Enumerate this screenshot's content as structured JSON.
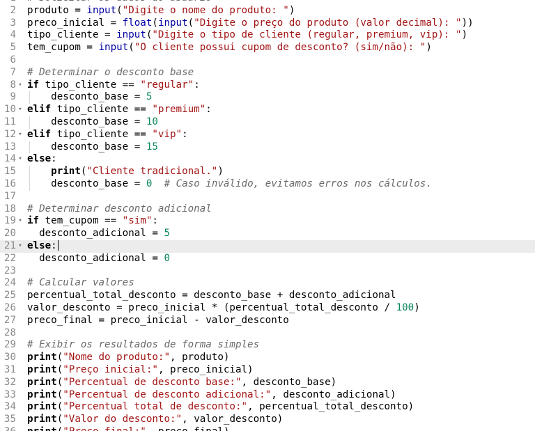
{
  "editor": {
    "colors": {
      "keyword": "#000000",
      "function": "#0000a2",
      "string": "#a31515",
      "number": "#098658",
      "comment": "#6a6a6a",
      "gutter": "#8a8a8a",
      "active_line": "#ececec"
    },
    "fold_marker": "▾",
    "active_line_number": 21,
    "lines": [
      {
        "n": 1,
        "fold": false,
        "indent": 0,
        "tokens": [
          {
            "t": "com",
            "v": "# Solicitar os dados do usuário"
          }
        ]
      },
      {
        "n": 2,
        "fold": false,
        "indent": 0,
        "tokens": [
          {
            "t": "txt",
            "v": "produto = "
          },
          {
            "t": "fn",
            "v": "input"
          },
          {
            "t": "txt",
            "v": "("
          },
          {
            "t": "str",
            "v": "\"Digite o nome do produto: \""
          },
          {
            "t": "txt",
            "v": ")"
          }
        ]
      },
      {
        "n": 3,
        "fold": false,
        "indent": 0,
        "tokens": [
          {
            "t": "txt",
            "v": "preco_inicial = "
          },
          {
            "t": "fn",
            "v": "float"
          },
          {
            "t": "txt",
            "v": "("
          },
          {
            "t": "fn",
            "v": "input"
          },
          {
            "t": "txt",
            "v": "("
          },
          {
            "t": "str",
            "v": "\"Digite o preço do produto (valor decimal): \""
          },
          {
            "t": "txt",
            "v": "))"
          }
        ]
      },
      {
        "n": 4,
        "fold": false,
        "indent": 0,
        "tokens": [
          {
            "t": "txt",
            "v": "tipo_cliente = "
          },
          {
            "t": "fn",
            "v": "input"
          },
          {
            "t": "txt",
            "v": "("
          },
          {
            "t": "str",
            "v": "\"Digite o tipo de cliente (regular, premium, vip): \""
          },
          {
            "t": "txt",
            "v": ")"
          }
        ]
      },
      {
        "n": 5,
        "fold": false,
        "indent": 0,
        "tokens": [
          {
            "t": "txt",
            "v": "tem_cupom = "
          },
          {
            "t": "fn",
            "v": "input"
          },
          {
            "t": "txt",
            "v": "("
          },
          {
            "t": "str",
            "v": "\"O cliente possui cupom de desconto? (sim/não): \""
          },
          {
            "t": "txt",
            "v": ")"
          }
        ]
      },
      {
        "n": 6,
        "fold": false,
        "indent": 0,
        "tokens": []
      },
      {
        "n": 7,
        "fold": false,
        "indent": 0,
        "tokens": [
          {
            "t": "com",
            "v": "# Determinar o desconto base"
          }
        ]
      },
      {
        "n": 8,
        "fold": true,
        "indent": 0,
        "tokens": [
          {
            "t": "kw",
            "v": "if"
          },
          {
            "t": "txt",
            "v": " tipo_cliente == "
          },
          {
            "t": "str",
            "v": "\"regular\""
          },
          {
            "t": "txt",
            "v": ":"
          }
        ]
      },
      {
        "n": 9,
        "fold": false,
        "indent": 1,
        "tokens": [
          {
            "t": "txt",
            "v": "    desconto_base = "
          },
          {
            "t": "num",
            "v": "5"
          }
        ]
      },
      {
        "n": 10,
        "fold": true,
        "indent": 0,
        "tokens": [
          {
            "t": "kw",
            "v": "elif"
          },
          {
            "t": "txt",
            "v": " tipo_cliente == "
          },
          {
            "t": "str",
            "v": "\"premium\""
          },
          {
            "t": "txt",
            "v": ":"
          }
        ]
      },
      {
        "n": 11,
        "fold": false,
        "indent": 1,
        "tokens": [
          {
            "t": "txt",
            "v": "    desconto_base = "
          },
          {
            "t": "num",
            "v": "10"
          }
        ]
      },
      {
        "n": 12,
        "fold": true,
        "indent": 0,
        "tokens": [
          {
            "t": "kw",
            "v": "elif"
          },
          {
            "t": "txt",
            "v": " tipo_cliente == "
          },
          {
            "t": "str",
            "v": "\"vip\""
          },
          {
            "t": "txt",
            "v": ":"
          }
        ]
      },
      {
        "n": 13,
        "fold": false,
        "indent": 1,
        "tokens": [
          {
            "t": "txt",
            "v": "    desconto_base = "
          },
          {
            "t": "num",
            "v": "15"
          }
        ]
      },
      {
        "n": 14,
        "fold": true,
        "indent": 0,
        "tokens": [
          {
            "t": "kw",
            "v": "else"
          },
          {
            "t": "txt",
            "v": ":"
          }
        ]
      },
      {
        "n": 15,
        "fold": false,
        "indent": 1,
        "tokens": [
          {
            "t": "txt",
            "v": "    "
          },
          {
            "t": "kw",
            "v": "print"
          },
          {
            "t": "txt",
            "v": "("
          },
          {
            "t": "str",
            "v": "\"Cliente tradicional.\""
          },
          {
            "t": "txt",
            "v": ")"
          }
        ]
      },
      {
        "n": 16,
        "fold": false,
        "indent": 1,
        "tokens": [
          {
            "t": "txt",
            "v": "    desconto_base = "
          },
          {
            "t": "num",
            "v": "0"
          },
          {
            "t": "txt",
            "v": "  "
          },
          {
            "t": "com",
            "v": "# Caso inválido, evitamos erros nos cálculos."
          }
        ]
      },
      {
        "n": 17,
        "fold": false,
        "indent": 0,
        "tokens": []
      },
      {
        "n": 18,
        "fold": false,
        "indent": 0,
        "tokens": [
          {
            "t": "com",
            "v": "# Determinar desconto adicional"
          }
        ]
      },
      {
        "n": 19,
        "fold": true,
        "indent": 0,
        "tokens": [
          {
            "t": "kw",
            "v": "if"
          },
          {
            "t": "txt",
            "v": " tem_cupom == "
          },
          {
            "t": "str",
            "v": "\"sim\""
          },
          {
            "t": "txt",
            "v": ":"
          }
        ]
      },
      {
        "n": 20,
        "fold": false,
        "indent": 0,
        "tokens": [
          {
            "t": "txt",
            "v": "  desconto_adicional = "
          },
          {
            "t": "num",
            "v": "5"
          }
        ]
      },
      {
        "n": 21,
        "fold": true,
        "indent": 0,
        "tokens": [
          {
            "t": "kw",
            "v": "else"
          },
          {
            "t": "txt",
            "v": ":"
          }
        ]
      },
      {
        "n": 22,
        "fold": false,
        "indent": 0,
        "tokens": [
          {
            "t": "txt",
            "v": "  desconto_adicional = "
          },
          {
            "t": "num",
            "v": "0"
          }
        ]
      },
      {
        "n": 23,
        "fold": false,
        "indent": 0,
        "tokens": []
      },
      {
        "n": 24,
        "fold": false,
        "indent": 0,
        "tokens": [
          {
            "t": "com",
            "v": "# Calcular valores"
          }
        ]
      },
      {
        "n": 25,
        "fold": false,
        "indent": 0,
        "tokens": [
          {
            "t": "txt",
            "v": "percentual_total_desconto = desconto_base + desconto_adicional"
          }
        ]
      },
      {
        "n": 26,
        "fold": false,
        "indent": 0,
        "tokens": [
          {
            "t": "txt",
            "v": "valor_desconto = preco_inicial * (percentual_total_desconto / "
          },
          {
            "t": "num",
            "v": "100"
          },
          {
            "t": "txt",
            "v": ")"
          }
        ]
      },
      {
        "n": 27,
        "fold": false,
        "indent": 0,
        "tokens": [
          {
            "t": "txt",
            "v": "preco_final = preco_inicial - valor_desconto"
          }
        ]
      },
      {
        "n": 28,
        "fold": false,
        "indent": 0,
        "tokens": []
      },
      {
        "n": 29,
        "fold": false,
        "indent": 0,
        "tokens": [
          {
            "t": "com",
            "v": "# Exibir os resultados de forma simples"
          }
        ]
      },
      {
        "n": 30,
        "fold": false,
        "indent": 0,
        "tokens": [
          {
            "t": "kw",
            "v": "print"
          },
          {
            "t": "txt",
            "v": "("
          },
          {
            "t": "str",
            "v": "\"Nome do produto:\""
          },
          {
            "t": "txt",
            "v": ", produto)"
          }
        ]
      },
      {
        "n": 31,
        "fold": false,
        "indent": 0,
        "tokens": [
          {
            "t": "kw",
            "v": "print"
          },
          {
            "t": "txt",
            "v": "("
          },
          {
            "t": "str",
            "v": "\"Preço inicial:\""
          },
          {
            "t": "txt",
            "v": ", preco_inicial)"
          }
        ]
      },
      {
        "n": 32,
        "fold": false,
        "indent": 0,
        "tokens": [
          {
            "t": "kw",
            "v": "print"
          },
          {
            "t": "txt",
            "v": "("
          },
          {
            "t": "str",
            "v": "\"Percentual de desconto base:\""
          },
          {
            "t": "txt",
            "v": ", desconto_base)"
          }
        ]
      },
      {
        "n": 33,
        "fold": false,
        "indent": 0,
        "tokens": [
          {
            "t": "kw",
            "v": "print"
          },
          {
            "t": "txt",
            "v": "("
          },
          {
            "t": "str",
            "v": "\"Percentual de desconto adicional:\""
          },
          {
            "t": "txt",
            "v": ", desconto_adicional)"
          }
        ]
      },
      {
        "n": 34,
        "fold": false,
        "indent": 0,
        "tokens": [
          {
            "t": "kw",
            "v": "print"
          },
          {
            "t": "txt",
            "v": "("
          },
          {
            "t": "str",
            "v": "\"Percentual total de desconto:\""
          },
          {
            "t": "txt",
            "v": ", percentual_total_desconto)"
          }
        ]
      },
      {
        "n": 35,
        "fold": false,
        "indent": 0,
        "tokens": [
          {
            "t": "kw",
            "v": "print"
          },
          {
            "t": "txt",
            "v": "("
          },
          {
            "t": "str",
            "v": "\"Valor do desconto:\""
          },
          {
            "t": "txt",
            "v": ", valor_desconto)"
          }
        ]
      },
      {
        "n": 36,
        "fold": false,
        "indent": 0,
        "tokens": [
          {
            "t": "kw",
            "v": "print"
          },
          {
            "t": "txt",
            "v": "("
          },
          {
            "t": "str",
            "v": "\"Preço final:\""
          },
          {
            "t": "txt",
            "v": ", preco_final)"
          }
        ]
      }
    ]
  }
}
